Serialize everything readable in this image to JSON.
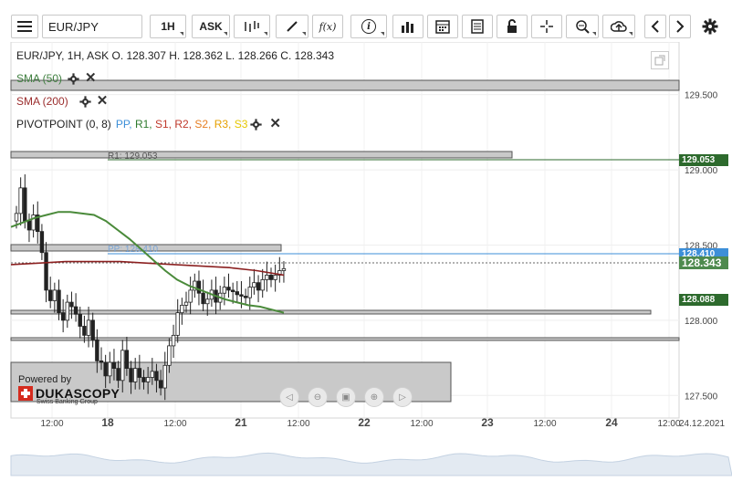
{
  "toolbar": {
    "symbol": "EUR/JPY",
    "timeframe": "1H",
    "price_side": "ASK",
    "fx_label": "f(x)",
    "icons": [
      "menu-icon",
      "candles-icon",
      "draw-icon",
      "function-icon",
      "info-icon",
      "bars-icon",
      "calendar-icon",
      "table-icon",
      "lock-icon",
      "crosshair-icon",
      "zoom-icon",
      "cloud-upload-icon",
      "arrow-left-icon",
      "arrow-right-icon",
      "gear-icon"
    ]
  },
  "header": {
    "ohlc": "EUR/JPY, 1H, ASK   O. 128.307 H. 128.362 L. 128.266 C. 128.343"
  },
  "indicators": [
    {
      "label": "SMA (50)",
      "color": "#3f7f3f"
    },
    {
      "label": "SMA (200)",
      "color": "#9b2d2d"
    }
  ],
  "pivot": {
    "label": "PIVOTPOINT (0, 8)",
    "parts": [
      {
        "text": "PP",
        "color": "#3d8fd8"
      },
      {
        "text": "R1",
        "color": "#2d7a2d"
      },
      {
        "text": "S1",
        "color": "#c0392b"
      },
      {
        "text": "R2",
        "color": "#c0392b"
      },
      {
        "text": "S2",
        "color": "#e67e22"
      },
      {
        "text": "R3",
        "color": "#e6a000"
      },
      {
        "text": "S3",
        "color": "#e6c700"
      }
    ]
  },
  "line_labels": {
    "r1": "R1: 129.053",
    "pp": "PP: 128.410"
  },
  "y_axis": {
    "ticks": [
      "129.500",
      "129.000",
      "128.500",
      "128.000",
      "127.500"
    ],
    "tags": [
      {
        "value": "129.053",
        "color": "#2d6a2d"
      },
      {
        "value": "128.410",
        "color": "#3d8fd8"
      },
      {
        "value": "128.343",
        "color": "#4e8a4e"
      },
      {
        "value": "128.088",
        "color": "#2d6a2d"
      }
    ]
  },
  "x_axis": {
    "ticks": [
      "12:00",
      "18",
      "12:00",
      "21",
      "12:00",
      "22",
      "12:00",
      "23",
      "12:00",
      "24",
      "12:00"
    ],
    "end_label": "24.12.2021"
  },
  "branding": {
    "powered_by": "Powered by",
    "name": "DUKASCOPY",
    "tagline": "Swiss Banking Group"
  },
  "chart_data": {
    "type": "candlestick",
    "symbol": "EUR/JPY",
    "timeframe": "1H",
    "last_ohlc": {
      "open": 128.307,
      "high": 128.362,
      "low": 128.266,
      "close": 128.343
    },
    "ylim": [
      127.35,
      129.85
    ],
    "levels": {
      "R1": 129.053,
      "PP": 128.41,
      "S1": 128.088
    },
    "close_series": [
      128.71,
      128.88,
      128.66,
      128.6,
      128.7,
      128.59,
      128.45,
      128.2,
      128.13,
      128.2,
      128.05,
      128.0,
      128.12,
      128.09,
      128.04,
      127.96,
      127.9,
      128.0,
      127.87,
      127.73,
      127.72,
      127.63,
      127.72,
      127.68,
      127.6,
      127.8,
      127.68,
      127.59,
      127.68,
      127.62,
      127.59,
      127.62,
      127.66,
      127.6,
      127.55,
      127.7,
      127.83,
      127.9,
      128.05,
      128.1,
      128.12,
      128.2,
      128.26,
      128.18,
      128.11,
      128.14,
      128.2,
      128.12,
      128.18,
      128.22,
      128.2,
      128.19,
      128.17,
      128.16,
      128.15,
      128.22,
      128.25,
      128.2,
      128.27,
      128.3,
      128.27,
      128.3,
      128.33,
      128.343
    ],
    "sma50": [
      128.62,
      128.65,
      128.68,
      128.7,
      128.72,
      128.72,
      128.71,
      128.7,
      128.66,
      128.6,
      128.54,
      128.47,
      128.4,
      128.33,
      128.27,
      128.23,
      128.2,
      128.17,
      128.14,
      128.12,
      128.1,
      128.09,
      128.07,
      128.05
    ],
    "sma200": [
      128.37,
      128.38,
      128.39,
      128.39,
      128.39,
      128.38,
      128.37,
      128.36,
      128.35,
      128.33,
      128.3
    ]
  }
}
